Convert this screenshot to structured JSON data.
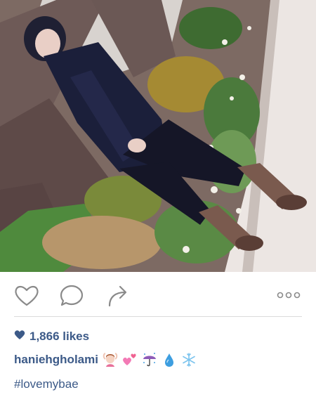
{
  "post": {
    "image_alt": "Woman in a dark coat and knit leg warmers standing beside a garden hedge",
    "likes_text": "1,866 likes",
    "username": "haniehgholami",
    "caption_emojis": [
      "woman-gesturing-ok",
      "pink-hearts",
      "umbrella-rain",
      "droplet",
      "snowflake"
    ],
    "hashtag": "#lovemybae"
  },
  "icons": {
    "like": "heart-icon",
    "comment": "comment-bubble-icon",
    "share": "share-arrow-icon",
    "more": "more-options-icon"
  },
  "colors": {
    "link": "#3c5a88",
    "icon_stroke": "#8a8a8a",
    "divider": "#dbdbdb"
  }
}
